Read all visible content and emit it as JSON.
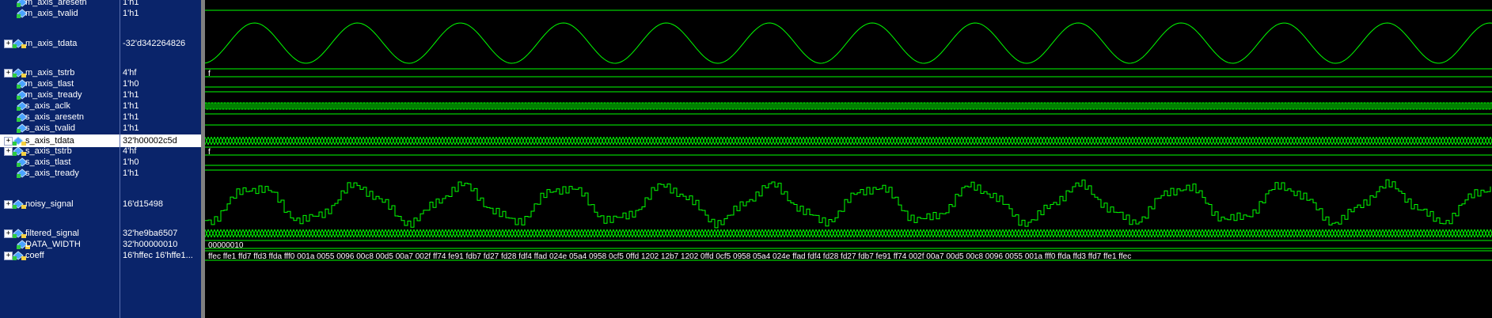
{
  "signals": [
    {
      "name": "m_axis_aresetn",
      "value": "1'h1",
      "type": "level",
      "bus": false,
      "expand": false
    },
    {
      "name": "m_axis_tvalid",
      "value": "1'h1",
      "type": "level",
      "bus": false,
      "expand": false
    },
    {
      "name": "m_axis_tdata",
      "value": "-32'd342264826",
      "type": "sine",
      "bus": true,
      "expand": true
    },
    {
      "name": "m_axis_tstrb",
      "value": "4'hf",
      "type": "label",
      "bus": true,
      "expand": true,
      "wave_text": "f"
    },
    {
      "name": "m_axis_tlast",
      "value": "1'h0",
      "type": "level",
      "bus": false,
      "expand": false
    },
    {
      "name": "m_axis_tready",
      "value": "1'h1",
      "type": "level",
      "bus": false,
      "expand": false
    },
    {
      "name": "s_axis_aclk",
      "value": "1'h1",
      "type": "clock",
      "bus": false,
      "expand": false
    },
    {
      "name": "s_axis_aresetn",
      "value": "1'h1",
      "type": "level",
      "bus": false,
      "expand": false
    },
    {
      "name": "s_axis_tvalid",
      "value": "1'h1",
      "type": "level",
      "bus": false,
      "expand": false
    },
    {
      "name": "s_axis_tdata",
      "value": "32'h00002c5d",
      "type": "dense",
      "bus": true,
      "expand": true,
      "selected": true
    },
    {
      "name": "s_axis_tstrb",
      "value": "4'hf",
      "type": "label",
      "bus": true,
      "expand": true,
      "wave_text": "f"
    },
    {
      "name": "s_axis_tlast",
      "value": "1'h0",
      "type": "level",
      "bus": false,
      "expand": false
    },
    {
      "name": "s_axis_tready",
      "value": "1'h1",
      "type": "level",
      "bus": false,
      "expand": false
    },
    {
      "name": "noisy_signal",
      "value": "16'd15498",
      "type": "noisy",
      "bus": true,
      "expand": true
    },
    {
      "name": "filtered_signal",
      "value": "32'he9ba6507",
      "type": "dense",
      "bus": true,
      "expand": true
    },
    {
      "name": "DATA_WIDTH",
      "value": "32'h00000010",
      "type": "label",
      "bus": true,
      "expand": false,
      "wave_text": "00000010"
    },
    {
      "name": "coeff",
      "value": "16'hffec 16'hffe1...",
      "type": "coeff",
      "bus": true,
      "expand": true,
      "wave_text": "ffec ffe1 ffd7 ffd3 ffda fff0 001a 0055 0096 00c8 00d5 00a7 002f ff74 fe91 fdb7 fd27 fd28 fdf4 ffad 024e 05a4 0958 0cf5 0ffd 1202 12b7 1202 0ffd 0cf5 0958 05a4 024e ffad fdf4 fd28 fd27 fdb7 fe91 ff74 002f 00a7 00d5 00c8 0096 0055 001a fff0 ffda ffd3 ffd7 ffe1 ffec"
    }
  ],
  "colors": {
    "wave": "#00ff00",
    "grid": "#00ff00",
    "selected_bg": "#ffffff",
    "panel_bg": "#0a246a"
  }
}
